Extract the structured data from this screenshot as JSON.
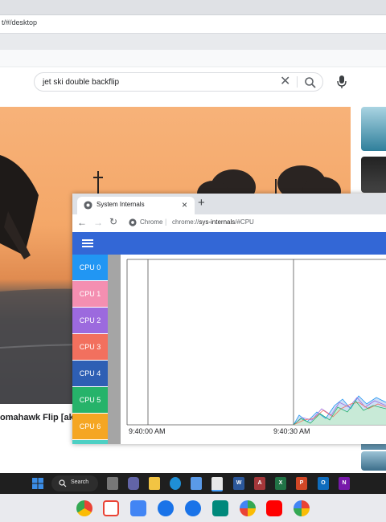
{
  "back_browser": {
    "url": "t/#/desktop",
    "search": {
      "query": "jet ski double backflip"
    },
    "result": {
      "caption": "omahawk Flip [aka"
    }
  },
  "window": {
    "tab_title": "System Internals",
    "origin": "Chrome",
    "url_prefix": "chrome://",
    "url_host": "sys-internals",
    "url_path": "/#CPU"
  },
  "cpus": [
    {
      "label": "CPU 0",
      "color": "#2196f3"
    },
    {
      "label": "CPU 1",
      "color": "#f48fb1"
    },
    {
      "label": "CPU 2",
      "color": "#9c6ade"
    },
    {
      "label": "CPU 3",
      "color": "#f2705e"
    },
    {
      "label": "CPU 4",
      "color": "#2e5fb4"
    },
    {
      "label": "CPU 5",
      "color": "#26b36a"
    },
    {
      "label": "CPU 6",
      "color": "#f5a623"
    }
  ],
  "graph": {
    "time_labels": [
      "9:40:00 AM",
      "9:40:30 AM"
    ]
  },
  "taskbar": {
    "search_label": "Search"
  },
  "colors": {
    "accent": "#3367d6",
    "taskbar": "#1f1f1f"
  }
}
